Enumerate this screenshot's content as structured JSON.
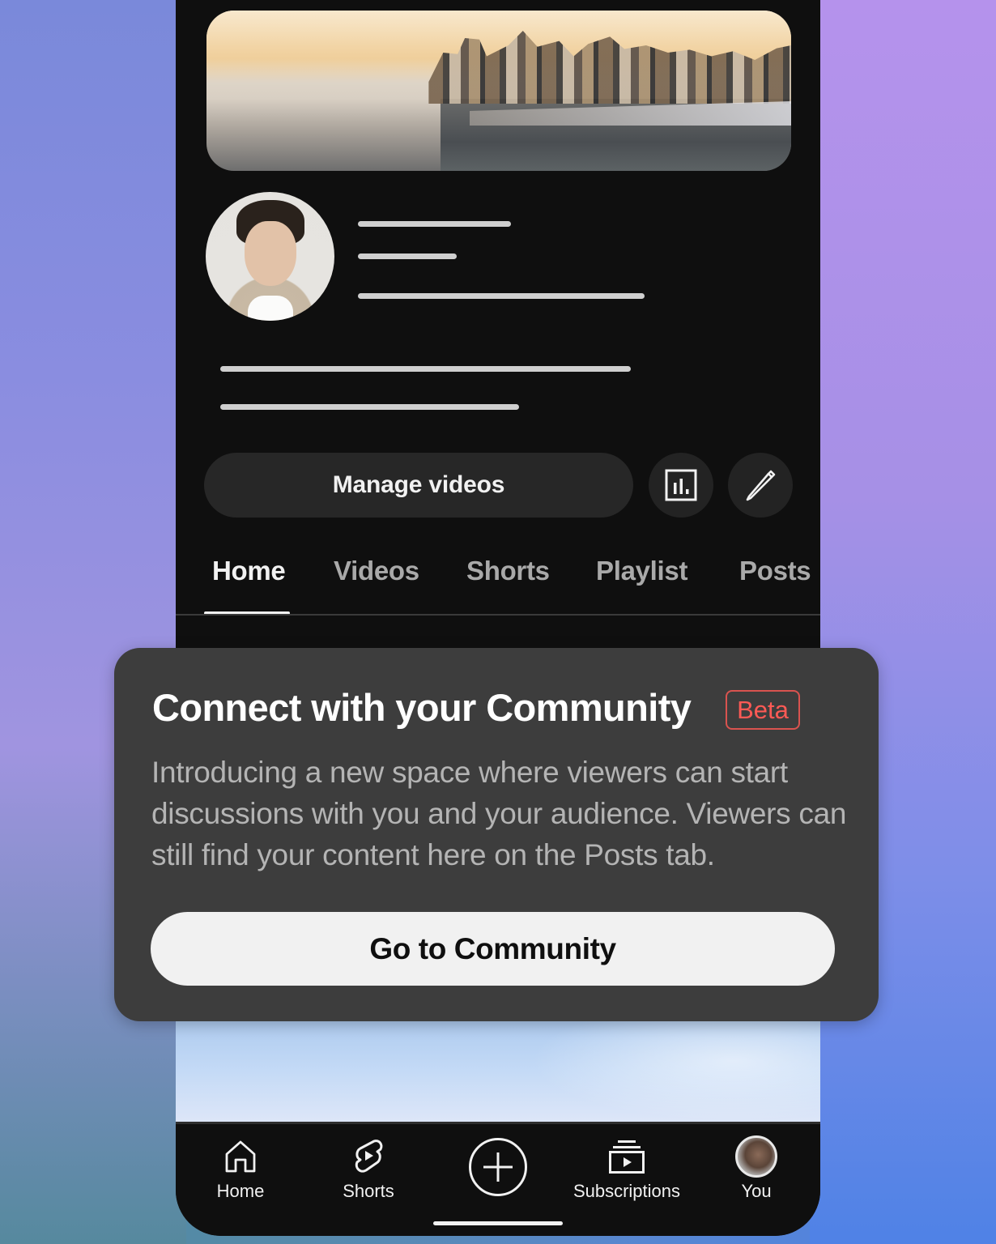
{
  "channel": {
    "banner_alt": "City skyline waterfront banner",
    "avatar_alt": "Channel profile photo"
  },
  "actions": {
    "manage_videos_label": "Manage videos",
    "analytics_icon": "analytics-icon",
    "edit_icon": "pencil-icon"
  },
  "tabs": [
    {
      "label": "Home",
      "active": true
    },
    {
      "label": "Videos",
      "active": false
    },
    {
      "label": "Shorts",
      "active": false
    },
    {
      "label": "Playlist",
      "active": false
    },
    {
      "label": "Posts",
      "active": false
    }
  ],
  "popup": {
    "title": "Connect with your Community",
    "badge": "Beta",
    "body": "Introducing a new space where viewers can start discussions with you and your audience. Viewers can still find your content here on the Posts tab.",
    "cta_label": "Go to Community"
  },
  "bottom_nav": [
    {
      "label": "Home",
      "icon": "home-icon"
    },
    {
      "label": "Shorts",
      "icon": "shorts-icon"
    },
    {
      "label": "",
      "icon": "create-plus-icon"
    },
    {
      "label": "Subscriptions",
      "icon": "subscriptions-icon"
    },
    {
      "label": "You",
      "icon": "user-avatar-icon"
    }
  ],
  "colors": {
    "background_dark": "#0f0f0f",
    "popup_bg": "#3d3d3d",
    "beta_red": "#ff5a55",
    "cta_bg": "#f1f1f1"
  }
}
